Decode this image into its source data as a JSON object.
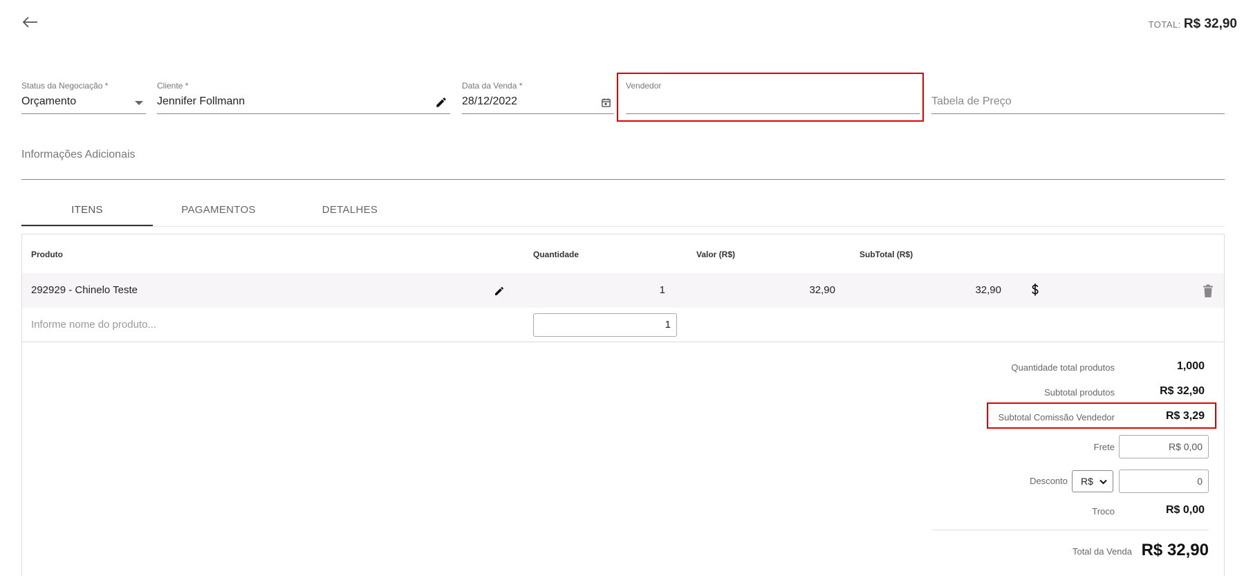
{
  "header": {
    "total_label": "TOTAL:",
    "total_value": "R$ 32,90"
  },
  "form": {
    "status": {
      "label": "Status da Negociação *",
      "value": "Orçamento"
    },
    "cliente": {
      "label": "Cliente *",
      "value": "Jennifer Follmann"
    },
    "data_venda": {
      "label": "Data da Venda *",
      "value": "28/12/2022"
    },
    "vendedor": {
      "label": "Vendedor",
      "value": ""
    },
    "tabela_preco": {
      "placeholder": "Tabela de Preço"
    },
    "info_adicionais": {
      "placeholder": "Informações Adicionais"
    }
  },
  "tabs": [
    {
      "label": "ITENS",
      "active": true
    },
    {
      "label": "PAGAMENTOS",
      "active": false
    },
    {
      "label": "DETALHES",
      "active": false
    }
  ],
  "table": {
    "columns": [
      "Produto",
      "Quantidade",
      "Valor (R$)",
      "SubTotal (R$)"
    ],
    "rows": [
      {
        "produto": "292929 - Chinelo Teste",
        "quantidade": "1",
        "valor": "32,90",
        "subtotal": "32,90"
      }
    ],
    "new_item": {
      "placeholder": "Informe nome do produto...",
      "quantidade": "1"
    }
  },
  "summary": {
    "qtd_total_label": "Quantidade total produtos",
    "qtd_total_value": "1,000",
    "subtotal_label": "Subtotal produtos",
    "subtotal_value": "R$ 32,90",
    "comissao_label": "Subtotal Comissão Vendedor",
    "comissao_value": "R$ 3,29",
    "frete_label": "Frete",
    "frete_placeholder": "R$ 0,00",
    "desconto_label": "Desconto",
    "desconto_currency": "R$",
    "desconto_value": "0",
    "troco_label": "Troco",
    "troco_value": "R$ 0,00",
    "total_label": "Total da Venda",
    "total_value": "R$ 32,90"
  },
  "colors": {
    "highlight": "#e00000",
    "text": "#222222",
    "row_bg": "#f7f5f7"
  }
}
